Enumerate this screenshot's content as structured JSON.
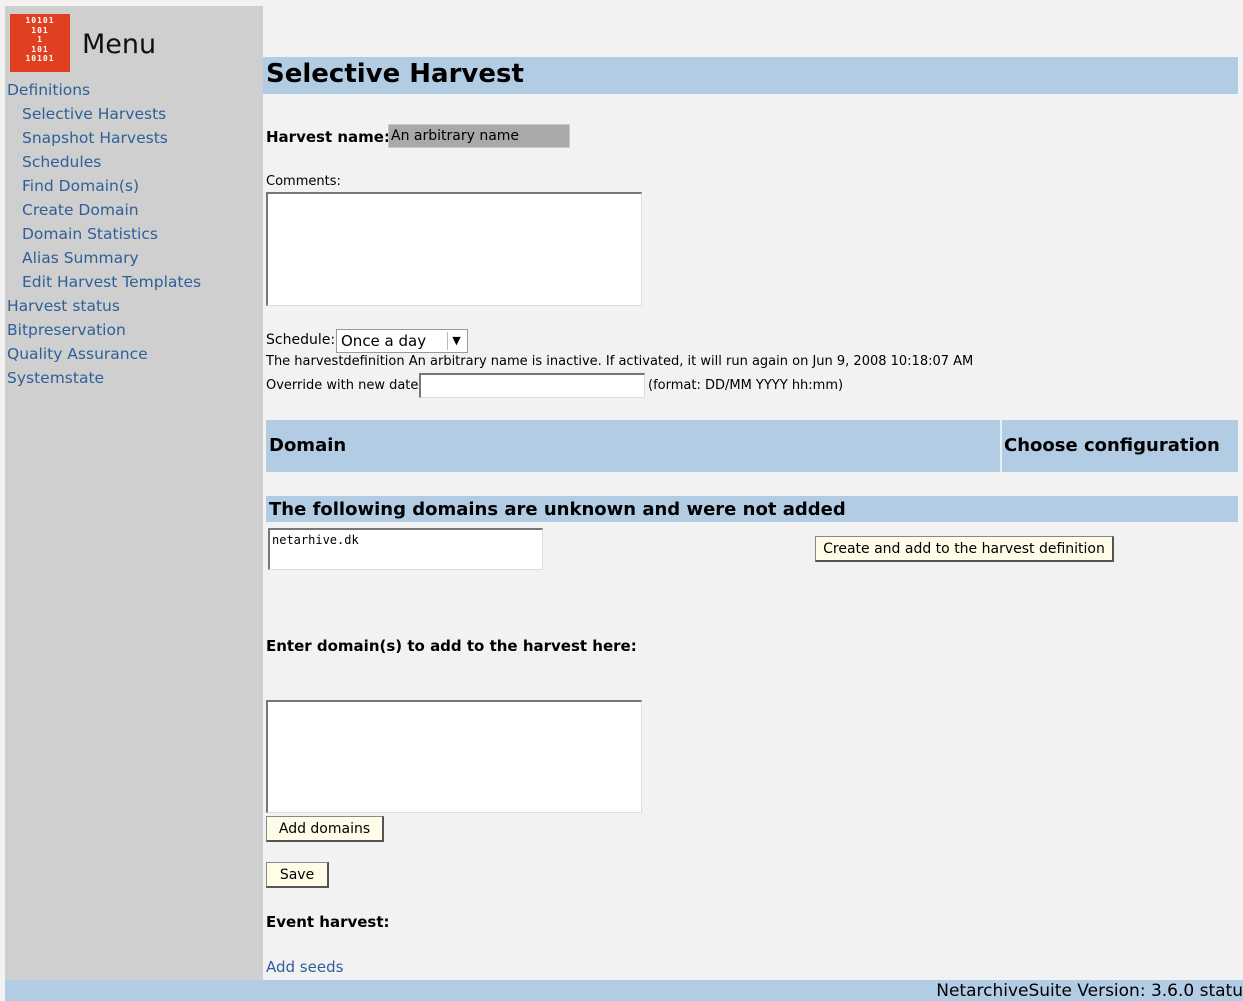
{
  "sidebar": {
    "logo_lines": [
      "10101",
      "101",
      "1",
      "101",
      "10101"
    ],
    "menu_title": "Menu",
    "items": [
      {
        "label": "Definitions",
        "level": 0
      },
      {
        "label": "Selective Harvests",
        "level": 1
      },
      {
        "label": "Snapshot Harvests",
        "level": 1
      },
      {
        "label": "Schedules",
        "level": 1
      },
      {
        "label": "Find Domain(s)",
        "level": 1
      },
      {
        "label": "Create Domain",
        "level": 1
      },
      {
        "label": "Domain Statistics",
        "level": 1
      },
      {
        "label": "Alias Summary",
        "level": 1
      },
      {
        "label": "Edit Harvest Templates",
        "level": 1
      },
      {
        "label": "Harvest status",
        "level": 0
      },
      {
        "label": "Bitpreservation",
        "level": 0
      },
      {
        "label": "Quality Assurance",
        "level": 0
      },
      {
        "label": "Systemstate",
        "level": 0
      }
    ]
  },
  "main": {
    "page_title": "Selective Harvest",
    "harvest_name_label": "Harvest name:",
    "harvest_name_value": "An arbitrary name",
    "comments_label": "Comments:",
    "comments_value": "",
    "schedule_label": "Schedule:",
    "schedule_selected": "Once a day",
    "inactive_text": "The harvestdefinition An arbitrary name is inactive. If activated, it will run again on Jun 9, 2008 10:18:07 AM",
    "override_label": "Override with new date",
    "override_value": "",
    "override_format": "(format: DD/MM YYYY hh:mm)",
    "table_headers": {
      "domain": "Domain",
      "config": "Choose configuration"
    },
    "unknown_heading": "The following domains are unknown and were not added",
    "unknown_domains": "netarhive.dk",
    "create_button": "Create and add to the harvest definition",
    "enter_domains_label": "Enter domain(s) to add to the harvest here:",
    "add_domains_button": "Add domains",
    "save_button": "Save",
    "event_harvest_label": "Event harvest:",
    "add_seeds_link": "Add seeds"
  },
  "footer": {
    "text": "NetarchiveSuite Version: 3.6.0 statu"
  },
  "colors": {
    "accent_bar": "#b2cce4",
    "link": "#2f5f98",
    "logo": "#e0401f",
    "sidebar": "#cfcfcf"
  }
}
